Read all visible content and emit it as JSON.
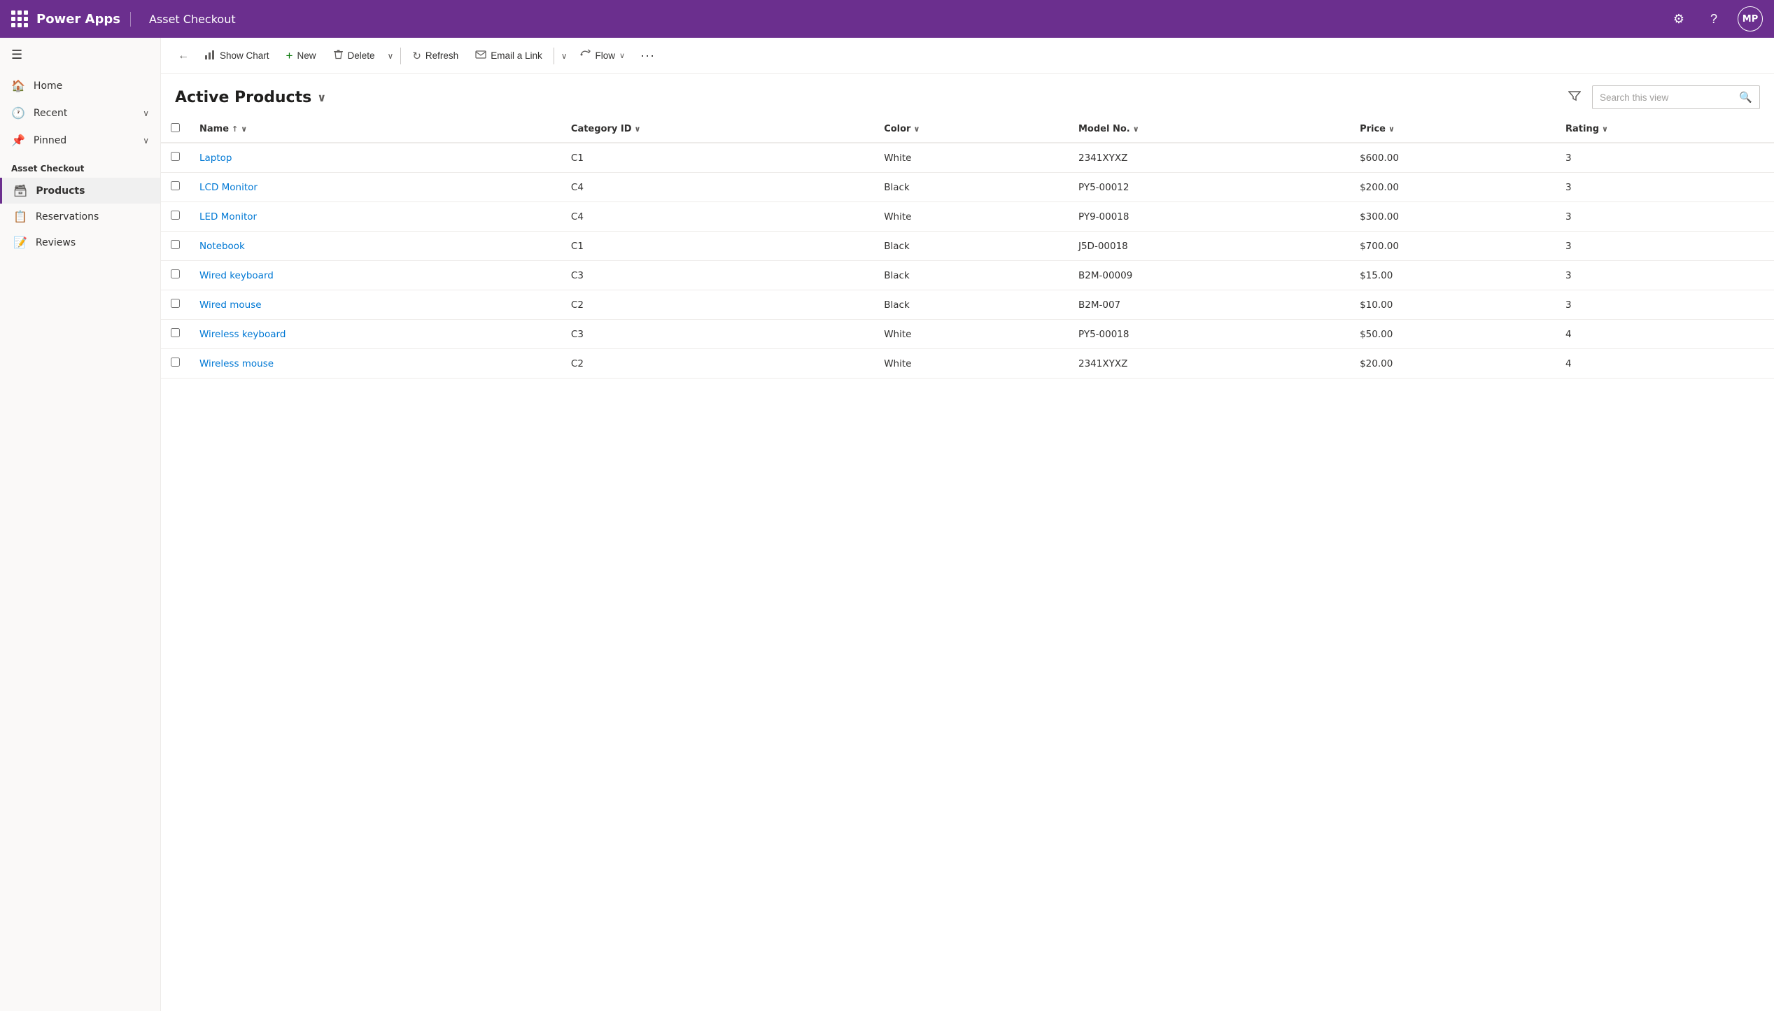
{
  "topbar": {
    "brand": "Power Apps",
    "app_title": "Asset Checkout",
    "avatar_label": "MP",
    "settings_icon": "⚙",
    "help_icon": "?",
    "grid_icon": "grid"
  },
  "sidebar": {
    "nav_items": [
      {
        "id": "home",
        "label": "Home",
        "icon": "🏠"
      },
      {
        "id": "recent",
        "label": "Recent",
        "icon": "🕐",
        "has_chevron": true
      },
      {
        "id": "pinned",
        "label": "Pinned",
        "icon": "📌",
        "has_chevron": true
      }
    ],
    "section_title": "Asset Checkout",
    "app_items": [
      {
        "id": "products",
        "label": "Products",
        "icon": "🗃",
        "active": true
      },
      {
        "id": "reservations",
        "label": "Reservations",
        "icon": "📋",
        "active": false
      },
      {
        "id": "reviews",
        "label": "Reviews",
        "icon": "📝",
        "active": false
      }
    ]
  },
  "toolbar": {
    "back_label": "←",
    "show_chart_label": "Show Chart",
    "new_label": "New",
    "delete_label": "Delete",
    "refresh_label": "Refresh",
    "email_link_label": "Email a Link",
    "flow_label": "Flow",
    "more_label": "···"
  },
  "view": {
    "title": "Active Products",
    "search_placeholder": "Search this view"
  },
  "table": {
    "columns": [
      {
        "id": "name",
        "label": "Name",
        "sort": "↑",
        "has_chevron": true
      },
      {
        "id": "category_id",
        "label": "Category ID",
        "has_chevron": true
      },
      {
        "id": "color",
        "label": "Color",
        "has_chevron": true
      },
      {
        "id": "model_no",
        "label": "Model No.",
        "has_chevron": true
      },
      {
        "id": "price",
        "label": "Price",
        "has_chevron": true
      },
      {
        "id": "rating",
        "label": "Rating",
        "has_chevron": true
      }
    ],
    "rows": [
      {
        "name": "Laptop",
        "category_id": "C1",
        "color": "White",
        "model_no": "2341XYXZ",
        "price": "$600.00",
        "rating": "3"
      },
      {
        "name": "LCD Monitor",
        "category_id": "C4",
        "color": "Black",
        "model_no": "PY5-00012",
        "price": "$200.00",
        "rating": "3"
      },
      {
        "name": "LED Monitor",
        "category_id": "C4",
        "color": "White",
        "model_no": "PY9-00018",
        "price": "$300.00",
        "rating": "3"
      },
      {
        "name": "Notebook",
        "category_id": "C1",
        "color": "Black",
        "model_no": "J5D-00018",
        "price": "$700.00",
        "rating": "3"
      },
      {
        "name": "Wired keyboard",
        "category_id": "C3",
        "color": "Black",
        "model_no": "B2M-00009",
        "price": "$15.00",
        "rating": "3"
      },
      {
        "name": "Wired mouse",
        "category_id": "C2",
        "color": "Black",
        "model_no": "B2M-007",
        "price": "$10.00",
        "rating": "3"
      },
      {
        "name": "Wireless keyboard",
        "category_id": "C3",
        "color": "White",
        "model_no": "PY5-00018",
        "price": "$50.00",
        "rating": "4"
      },
      {
        "name": "Wireless mouse",
        "category_id": "C2",
        "color": "White",
        "model_no": "2341XYXZ",
        "price": "$20.00",
        "rating": "4"
      }
    ]
  },
  "colors": {
    "topbar_bg": "#6b2f8e",
    "link_color": "#0078d4",
    "active_border": "#6b2f8e"
  }
}
